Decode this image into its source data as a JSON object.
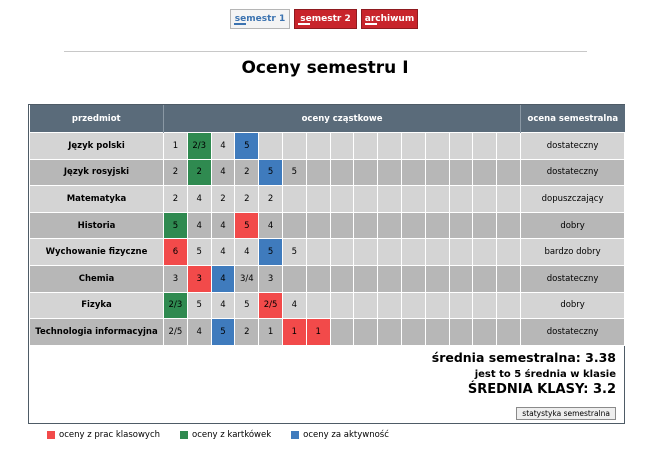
{
  "tabs": [
    {
      "label": "semestr 1",
      "active": true
    },
    {
      "label": "semestr 2",
      "active": false
    },
    {
      "label": "archiwum",
      "active": false
    }
  ],
  "page_title": "Oceny semestru I",
  "table": {
    "headers": {
      "subject": "przedmiot",
      "partial": "oceny cząstkowe",
      "final": "ocena semestralna"
    },
    "grade_columns": 15,
    "rows": [
      {
        "subject": "Język polski",
        "grades": [
          {
            "v": "1"
          },
          {
            "v": "2/3",
            "c": "green"
          },
          {
            "v": "4"
          },
          {
            "v": "5",
            "c": "blue"
          }
        ],
        "final": "dostateczny"
      },
      {
        "subject": "Język rosyjski",
        "grades": [
          {
            "v": "2"
          },
          {
            "v": "2",
            "c": "green"
          },
          {
            "v": "4"
          },
          {
            "v": "2"
          },
          {
            "v": "5",
            "c": "blue"
          },
          {
            "v": "5"
          }
        ],
        "final": "dostateczny"
      },
      {
        "subject": "Matematyka",
        "grades": [
          {
            "v": "2"
          },
          {
            "v": "4"
          },
          {
            "v": "2"
          },
          {
            "v": "2"
          },
          {
            "v": "2"
          }
        ],
        "final": "dopuszczający"
      },
      {
        "subject": "Historia",
        "grades": [
          {
            "v": "5",
            "c": "green"
          },
          {
            "v": "4"
          },
          {
            "v": "4"
          },
          {
            "v": "5",
            "c": "red"
          },
          {
            "v": "4"
          }
        ],
        "final": "dobry"
      },
      {
        "subject": "Wychowanie fizyczne",
        "grades": [
          {
            "v": "6",
            "c": "red"
          },
          {
            "v": "5"
          },
          {
            "v": "4"
          },
          {
            "v": "4"
          },
          {
            "v": "5",
            "c": "blue"
          },
          {
            "v": "5"
          }
        ],
        "final": "bardzo dobry"
      },
      {
        "subject": "Chemia",
        "grades": [
          {
            "v": "3"
          },
          {
            "v": "3",
            "c": "red"
          },
          {
            "v": "4",
            "c": "blue"
          },
          {
            "v": "3/4"
          },
          {
            "v": "3"
          }
        ],
        "final": "dostateczny"
      },
      {
        "subject": "Fizyka",
        "grades": [
          {
            "v": "2/3",
            "c": "green"
          },
          {
            "v": "5"
          },
          {
            "v": "4"
          },
          {
            "v": "5"
          },
          {
            "v": "2/5",
            "c": "red"
          },
          {
            "v": "4"
          }
        ],
        "final": "dobry"
      },
      {
        "subject": "Technologia informacyjna",
        "grades": [
          {
            "v": "2/5"
          },
          {
            "v": "4"
          },
          {
            "v": "5",
            "c": "blue"
          },
          {
            "v": "2"
          },
          {
            "v": "1"
          },
          {
            "v": "1",
            "c": "red"
          },
          {
            "v": "1",
            "c": "red"
          }
        ],
        "final": "dostateczny"
      }
    ]
  },
  "summary": {
    "semester_average": "średnia semestralna: 3.38",
    "class_rank": "jest to 5 średnia w klasie",
    "class_average": "ŚREDNIA KLASY: 3.2",
    "stats_button": "statystyka semestralna"
  },
  "legend": [
    {
      "label": "oceny z prac klasowych",
      "color": "#f24a4a"
    },
    {
      "label": "oceny z kartkówek",
      "color": "#2f8a50"
    },
    {
      "label": "oceny za aktywność",
      "color": "#3f7bbd"
    }
  ],
  "colors": {
    "header": "#5a6b7a",
    "row_light": "#d4d4d4",
    "row_dark": "#b7b7b7",
    "tab_red": "#c8242b",
    "tab_active_text": "#3c73b0"
  }
}
